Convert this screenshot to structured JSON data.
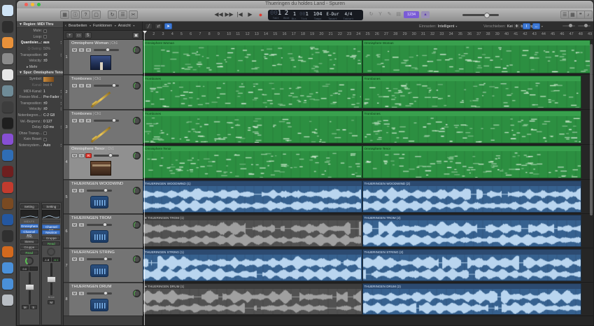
{
  "window": {
    "title": "Thueringen du holdes Land - Spuren"
  },
  "toolbar": {
    "left_icons": [
      {
        "name": "library-icon",
        "glyph": "▦"
      },
      {
        "name": "inspector-icon",
        "glyph": "ⓘ"
      },
      {
        "name": "quick-help-icon",
        "glyph": "?"
      },
      {
        "name": "toolbar-toggle-icon",
        "glyph": "▢"
      },
      {
        "name": "smart-controls-icon",
        "glyph": "↻"
      },
      {
        "name": "mixer-icon",
        "glyph": "☰"
      },
      {
        "name": "editors-icon",
        "glyph": "✂"
      }
    ],
    "transport": [
      {
        "name": "rewind-button",
        "glyph": "◀◀"
      },
      {
        "name": "forward-button",
        "glyph": "▶▶"
      },
      {
        "name": "go-to-start-button",
        "glyph": "|◀"
      },
      {
        "name": "play-button",
        "glyph": "▶"
      },
      {
        "name": "record-button",
        "glyph": "●"
      }
    ],
    "post_lcd_icons": [
      {
        "name": "cycle-icon",
        "glyph": "↻"
      },
      {
        "name": "tuner-icon",
        "glyph": "Y"
      },
      {
        "name": "pencil-icon",
        "glyph": "✎"
      },
      {
        "name": "list-icon",
        "glyph": "▤"
      }
    ],
    "badge_text": "1234",
    "metronome_glyph": "▲",
    "right_icons": [
      {
        "name": "list-editors-icon",
        "glyph": "☰"
      },
      {
        "name": "loop-browser-icon",
        "glyph": "▦"
      },
      {
        "name": "notes-icon",
        "glyph": "❝"
      },
      {
        "name": "media-browser-icon",
        "glyph": "♪"
      }
    ]
  },
  "lcd": {
    "bar": "1",
    "beat": "2",
    "div": "1",
    "tick": "1",
    "bar_label": "Takt",
    "beat_label": "Beat",
    "div_label": "Div.",
    "tick_label": "Tick",
    "tempo": "104",
    "tempo_label": "Tempo",
    "key": "E-Dur",
    "key_label": "Tonart",
    "sig": "4/4",
    "sig_label": "Taktart"
  },
  "track_area": {
    "back_glyph": "‹",
    "menus": [
      "Bearbeiten",
      "Funktionen",
      "Ansicht"
    ],
    "add_button": "+",
    "add_track_glyph": "▭",
    "solo_button": "S",
    "catch_glyph": "▣"
  },
  "snap_bar": {
    "snap_label": "Einrasten:",
    "snap_value": "Intelligent",
    "drag_label": "Verschieben:",
    "drag_value": "Keine Überlappung",
    "tools": [
      {
        "name": "automation-tool-icon",
        "glyph": "╱",
        "active": false
      },
      {
        "name": "flex-tool-icon",
        "glyph": "⇄",
        "active": false
      },
      {
        "name": "pointer-tool-button",
        "glyph": "➤",
        "active": true
      }
    ],
    "right_tools": [
      {
        "name": "move-tool-icon",
        "glyph": "✚",
        "active": false
      },
      {
        "name": "text-tool-button",
        "glyph": "I",
        "active": true
      },
      {
        "name": "link-button",
        "glyph": "↔",
        "active": true
      }
    ]
  },
  "ruler": {
    "first_bar": 2,
    "last_bar": 49
  },
  "inspector": {
    "region_header": "▼ Region: MIDI Thru",
    "region_params": [
      {
        "label": "Mute:",
        "type": "checkbox"
      },
      {
        "label": "Loop:",
        "type": "checkbox"
      },
      {
        "label": "Quantisier...:",
        "value": "aus",
        "stepper": true,
        "bold": true
      },
      {
        "label": "Q-Swing:",
        "value": "50%",
        "dim": true
      },
      {
        "label": "Transposition:",
        "value": "±0",
        "stepper": true
      },
      {
        "label": "Velocity:",
        "value": "±0"
      },
      {
        "label": "▸ Mehr",
        "type": "disclosure"
      }
    ],
    "track_header": "▼ Spur: Omnisphere Tenor",
    "track_params": [
      {
        "label": "Symbol:",
        "type": "image"
      },
      {
        "label": "Kanal:",
        "value": "Inst 4",
        "dim": true
      },
      {
        "label": "MIDI-Kanal:",
        "value": "1",
        "stepper": true
      },
      {
        "label": "Freeze-Mod...:",
        "value": "Pre-Fader",
        "stepper": true
      },
      {
        "label": "Transposition:",
        "value": "±0",
        "stepper": true
      },
      {
        "label": "Velocity:",
        "value": "±0",
        "stepper": true
      },
      {
        "label": "Notenbegren...:",
        "value": "C-2  G8"
      },
      {
        "label": "Vel.-Begrenz.:",
        "value": "0  127"
      },
      {
        "label": "Delay:",
        "value": "0,0 ms",
        "stepper": true
      },
      {
        "label": "Ohne Transp...",
        "type": "checkbox"
      },
      {
        "label": "Kein Reset:",
        "type": "checkbox"
      },
      {
        "label": "Notensystem...",
        "value": "Auto",
        "stepper": true
      }
    ]
  },
  "channel_strips": [
    {
      "setting": "Setting",
      "fx_label": "MIDI-FX",
      "plugins": [
        "Omnisphere",
        "Channel EQ"
      ],
      "send": "Send",
      "output": "Stereo",
      "group": "Gruppe",
      "automation": "Read",
      "values": [
        "0.0",
        ""
      ],
      "buttons": [
        "M",
        "S"
      ],
      "bounce": "",
      "knob_green": true
    },
    {
      "setting": "Setting",
      "fx_label": "",
      "plugins": [
        "Channel EQ",
        "Neutron"
      ],
      "send": "",
      "output": "",
      "group": "Gruppe",
      "automation": "Read",
      "values": [
        "-1.8",
        "-6.1"
      ],
      "buttons": [
        "M"
      ],
      "bounce": "Bnce",
      "knob_green": false
    }
  ],
  "tracks": [
    {
      "num": "1",
      "name": "Omnisphere Woman",
      "channel": "Ch1",
      "buttons": [
        "M",
        "S",
        "R"
      ],
      "record_armed": false,
      "selected": false,
      "icon": "choir-blue-photo",
      "volume_pct": 55,
      "kind": "midi",
      "regions": [
        {
          "label": "Omnisphere Woman",
          "start": 1,
          "end": 24.7,
          "muted": false
        },
        {
          "label": "Omnisphere Woman",
          "start": 24.7,
          "end": 49.4,
          "muted": false
        }
      ]
    },
    {
      "num": "2",
      "name": "Trombones",
      "channel": "Ch1",
      "buttons": [
        "M",
        "S",
        "R"
      ],
      "record_armed": false,
      "selected": false,
      "icon": "trombone-photo",
      "volume_pct": 80,
      "kind": "midi",
      "regions": [
        {
          "label": "Trombones",
          "start": 1,
          "end": 24.7,
          "muted": false
        },
        {
          "label": "Trombones",
          "start": 24.7,
          "end": 48.4,
          "muted": false
        }
      ]
    },
    {
      "num": "3",
      "name": "Trombones",
      "channel": "Ch1",
      "buttons": [
        "M",
        "S",
        "R"
      ],
      "record_armed": false,
      "selected": false,
      "icon": "trombone-photo",
      "volume_pct": 80,
      "kind": "midi",
      "regions": [
        {
          "label": "Trombones",
          "start": 1,
          "end": 24.7,
          "muted": false
        },
        {
          "label": "Trombones",
          "start": 24.7,
          "end": 48.4,
          "muted": false
        }
      ]
    },
    {
      "num": "4",
      "name": "Omnisphere Tenor",
      "channel": "Ch1",
      "buttons": [
        "M",
        "S",
        "R"
      ],
      "record_armed": true,
      "selected": true,
      "icon": "choir-warm-photo",
      "volume_pct": 68,
      "kind": "midi",
      "regions": [
        {
          "label": "Omnisphere Tenor",
          "start": 1,
          "end": 24.7,
          "muted": false
        },
        {
          "label": "Omnisphere Tenor",
          "start": 24.7,
          "end": 48.4,
          "muted": false
        }
      ]
    },
    {
      "num": "5",
      "name": "THUERINGEN WOODWIND",
      "channel": "",
      "buttons": [
        "M",
        "S"
      ],
      "record_armed": false,
      "selected": false,
      "icon": "audio-waveform-icon",
      "volume_pct": 75,
      "kind": "audio",
      "regions": [
        {
          "label": "THUERINGEN WOODWIND (1)",
          "start": 1,
          "end": 24.7,
          "muted": false
        },
        {
          "label": "THUERINGEN WOODWIND (2)",
          "start": 24.7,
          "end": 48.4,
          "muted": false
        }
      ]
    },
    {
      "num": "6",
      "name": "THUERINGEN TROM",
      "channel": "",
      "buttons": [
        "M",
        "S"
      ],
      "record_armed": false,
      "selected": false,
      "icon": "audio-waveform-icon",
      "volume_pct": 72,
      "kind": "audio",
      "regions": [
        {
          "label": "THUERINGEN TROM (1)",
          "start": 1,
          "end": 24.7,
          "muted": true
        },
        {
          "label": "THUERINGEN TROM (2)",
          "start": 24.7,
          "end": 48.4,
          "muted": false
        }
      ]
    },
    {
      "num": "7",
      "name": "THUERINGEN STRING",
      "channel": "",
      "buttons": [
        "M",
        "S"
      ],
      "record_armed": false,
      "selected": false,
      "icon": "audio-waveform-icon",
      "volume_pct": 75,
      "kind": "audio",
      "regions": [
        {
          "label": "THUERINGEN STRING (1)",
          "start": 1,
          "end": 24.7,
          "muted": false
        },
        {
          "label": "THUERINGEN STRING (2)",
          "start": 24.7,
          "end": 48.4,
          "muted": false
        }
      ]
    },
    {
      "num": "8",
      "name": "THUERINGEN DRUM",
      "channel": "",
      "buttons": [
        "M",
        "S"
      ],
      "record_armed": false,
      "selected": false,
      "icon": "audio-waveform-icon",
      "volume_pct": 75,
      "kind": "audio",
      "regions": [
        {
          "label": "THUERINGEN DRUM (1)",
          "start": 1,
          "end": 24.7,
          "muted": true
        },
        {
          "label": "THUERINGEN DRUM (2)",
          "start": 24.7,
          "end": 48.4,
          "muted": false
        }
      ]
    }
  ],
  "dock": {
    "apps": [
      {
        "color": "#cfe3f5"
      },
      {
        "color": "#2e2e2e"
      },
      {
        "color": "#e8913a"
      },
      {
        "color": "#8a8a8a"
      },
      {
        "color": "#e6e6e6"
      },
      {
        "color": "#6f8b97"
      },
      {
        "color": "#3d3d3d"
      },
      {
        "color": "#1f1f1f"
      },
      {
        "color": "#874fd4"
      },
      {
        "color": "#2f6db5"
      },
      {
        "color": "#6e1f1f"
      },
      {
        "color": "#c23b2e"
      },
      {
        "color": "#7a4a22"
      },
      {
        "color": "#2457a0"
      },
      {
        "color": "#303030"
      },
      {
        "color": "#d2691e"
      },
      {
        "color": "#4a90d9"
      },
      {
        "color": "#4a90d9"
      },
      {
        "color": "#b9bec4"
      }
    ]
  },
  "colors": {
    "midi_region_body": "#2c8f41",
    "midi_region_head": "#38a04d",
    "midi_label": "#0a3a14",
    "audio_region_body": "#36618f",
    "audio_region_head": "#2c4a70",
    "audio_label": "#d3e3f5",
    "muted_region_body": "#515151",
    "muted_region_head": "#3d3d3d",
    "muted_label": "#cccccc",
    "accent_blue": "#3f7ad6",
    "record_red": "#e0382e",
    "lcd_bg": "#171a20"
  }
}
